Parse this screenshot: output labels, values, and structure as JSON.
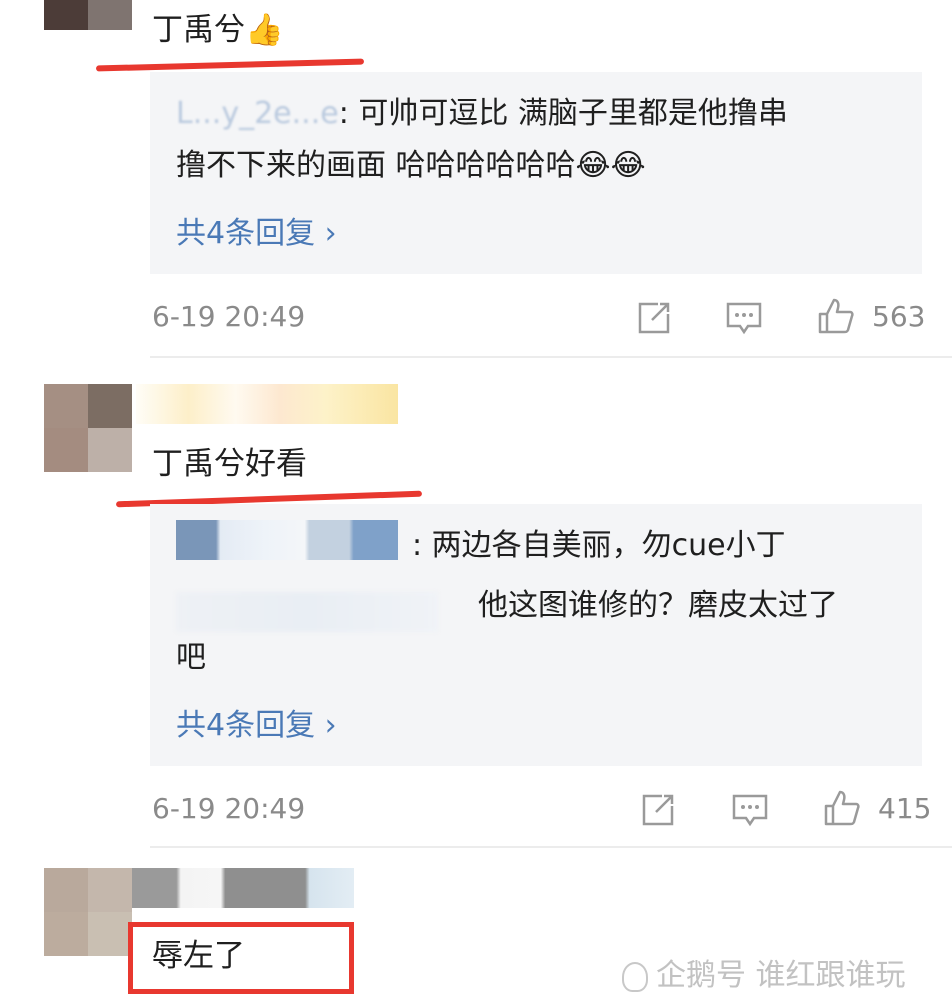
{
  "comments": [
    {
      "text": "丁禹兮",
      "emoji": "👍",
      "replies": [
        {
          "name": "L...y_2e...e",
          "text": ": 可帅可逗比 满脑子里都是他撸串"
        },
        {
          "name": "",
          "text": "撸不下来的画面 哈哈哈哈哈哈😂😂"
        }
      ],
      "view_replies": "共4条回复 ›",
      "timestamp": "6-19 20:49",
      "likes": "563"
    },
    {
      "text": "丁禹兮好看",
      "replies": [
        {
          "name": "",
          "text": ": 两边各自美丽，勿cue小丁"
        },
        {
          "name": "",
          "text": "他这图谁修的？磨皮太过了"
        },
        {
          "name": "",
          "text": "吧"
        }
      ],
      "view_replies": "共4条回复 ›",
      "timestamp": "6-19 20:49",
      "likes": "415"
    },
    {
      "text": "辱左了"
    }
  ],
  "watermark": "企鹅号 谁红跟谁玩",
  "colors": {
    "link": "#4a79b6",
    "highlight": "#e8382f",
    "reply_bg": "#f4f5f7"
  }
}
